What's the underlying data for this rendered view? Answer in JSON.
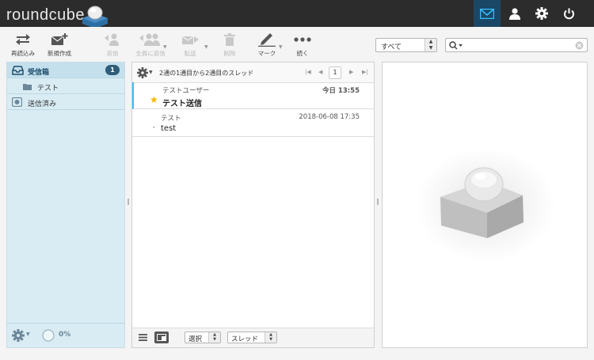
{
  "app": {
    "logo_text": "roundcube"
  },
  "topnav": [
    {
      "name": "mail-nav",
      "icon": "envelope-icon",
      "active": true
    },
    {
      "name": "contacts-nav",
      "icon": "person-icon",
      "active": false
    },
    {
      "name": "settings-nav",
      "icon": "gear-icon",
      "active": false
    },
    {
      "name": "logout-nav",
      "icon": "power-icon",
      "active": false
    }
  ],
  "toolbar": {
    "refresh": "再読込み",
    "compose": "新規作成",
    "reply": "返信",
    "reply_all": "全員に返信",
    "forward": "転送",
    "delete": "削除",
    "mark": "マーク",
    "more": "続く"
  },
  "filter": {
    "value": "すべて"
  },
  "search": {
    "placeholder": ""
  },
  "folders": [
    {
      "name": "受信箱",
      "unread": "1",
      "icon": "inbox-icon"
    },
    {
      "name": "テスト",
      "icon": "folder-icon"
    },
    {
      "name": "送信済み",
      "icon": "sent-icon"
    }
  ],
  "quota": {
    "value": "0%"
  },
  "list": {
    "count_text": "2通の1通目から2通目のスレッド",
    "page": "1",
    "messages": [
      {
        "from": "テストユーザー",
        "date": "今日 13:55",
        "subject": "テスト送信",
        "flagged": true,
        "unread": true
      },
      {
        "from": "テスト",
        "date": "2018-06-08 17:35",
        "subject": "test",
        "flagged": false,
        "unread": false
      }
    ]
  },
  "list_footer": {
    "select_label": "選択",
    "threads_label": "スレッド"
  },
  "colors": {
    "topbar": "#2c2c2c",
    "accent": "#37beff",
    "panel": "#d9ecf4",
    "badge": "#2e5d7a"
  }
}
